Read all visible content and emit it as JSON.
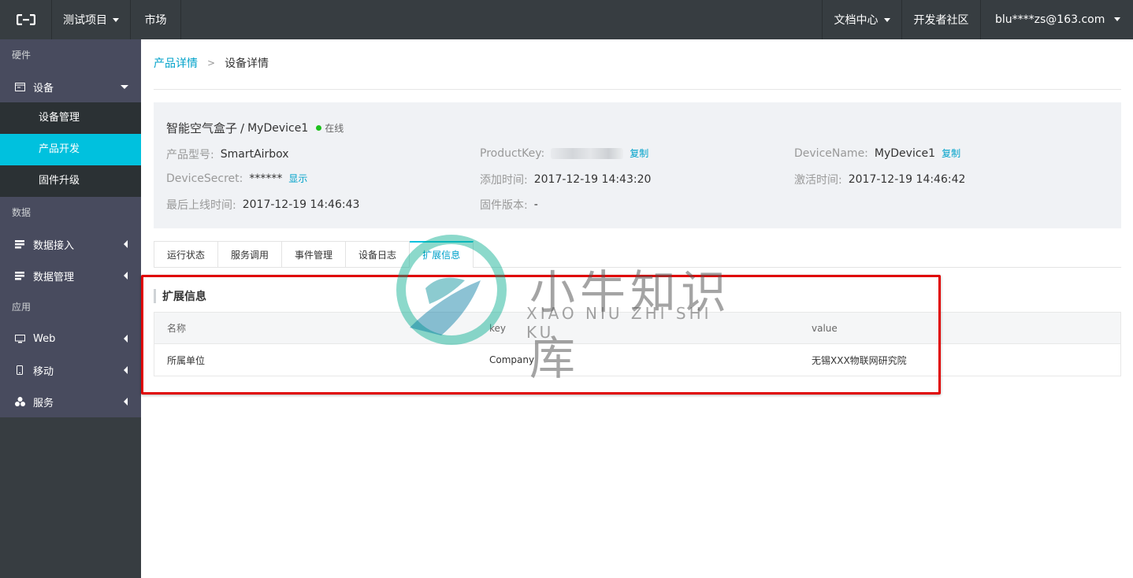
{
  "topbar": {
    "logo_icon": "aliyun-logo-icon",
    "project_label": "测试项目",
    "market_label": "市场",
    "docs_label": "文档中心",
    "dev_community_label": "开发者社区",
    "user_email": "blu****zs@163.com"
  },
  "sidebar": {
    "sec_hardware": "硬件",
    "device": "设备",
    "device_mgmt": "设备管理",
    "product_dev": "产品开发",
    "firmware": "固件升级",
    "sec_data": "数据",
    "data_access": "数据接入",
    "data_mgmt": "数据管理",
    "sec_app": "应用",
    "web": "Web",
    "mobile": "移动",
    "service": "服务"
  },
  "breadcrumb": {
    "parent": "产品详情",
    "current": "设备详情"
  },
  "device": {
    "product_name": "智能空气盒子",
    "separator": "/",
    "device_name": "MyDevice1",
    "status": "在线",
    "model_label": "产品型号:",
    "model_value": "SmartAirbox",
    "product_key_label": "ProductKey:",
    "copy": "复制",
    "device_name_label": "DeviceName:",
    "device_name_value": "MyDevice1",
    "secret_label": "DeviceSecret:",
    "secret_value": "******",
    "show": "显示",
    "added_label": "添加时间:",
    "added_value": "2017-12-19 14:43:20",
    "activated_label": "激活时间:",
    "activated_value": "2017-12-19 14:46:42",
    "last_online_label": "最后上线时间:",
    "last_online_value": "2017-12-19 14:46:43",
    "firmware_label": "固件版本:",
    "firmware_value": "-"
  },
  "tabs": [
    "运行状态",
    "服务调用",
    "事件管理",
    "设备日志",
    "扩展信息"
  ],
  "ext": {
    "title": "扩展信息",
    "columns": [
      "名称",
      "key",
      "value"
    ],
    "rows": [
      [
        "所属单位",
        "Company",
        "无锡XXX物联网研究院"
      ]
    ]
  },
  "watermark": {
    "text": "小牛知识库",
    "sub": "XIAO NIU ZHI SHI KU"
  },
  "colors": {
    "topbar": "#373d41",
    "accent": "#00c1de",
    "link": "#00a2ca",
    "online": "#1dc11d",
    "highlight_box": "#e00000"
  }
}
